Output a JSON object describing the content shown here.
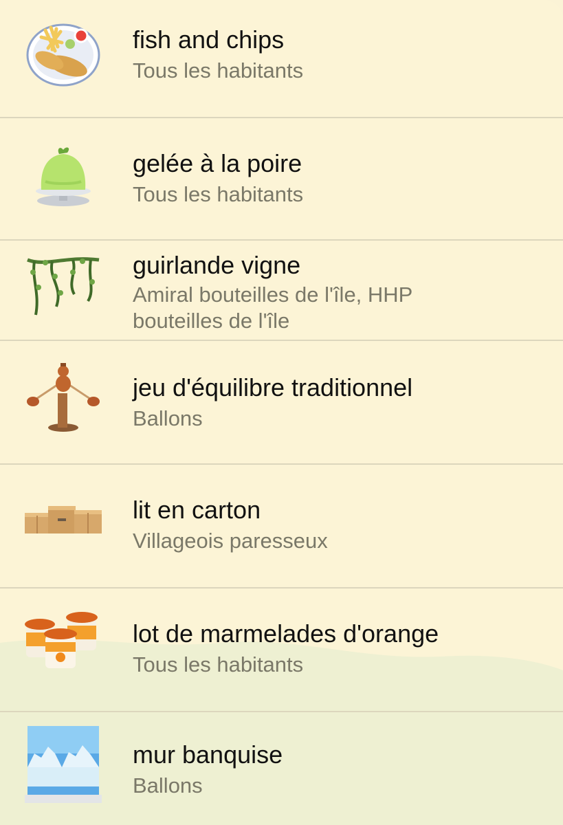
{
  "items": [
    {
      "title": "fish and chips",
      "subtitle": "Tous les habitants",
      "icon": "fish-and-chips-icon"
    },
    {
      "title": "gelée à la poire",
      "subtitle": "Tous les habitants",
      "icon": "pear-jelly-icon"
    },
    {
      "title": "guirlande vigne",
      "subtitle": "Amiral bouteilles de l'île, HHP bouteilles de l'île",
      "icon": "vine-garland-icon"
    },
    {
      "title": "jeu d'équilibre traditionnel",
      "subtitle": "Ballons",
      "icon": "balance-toy-icon"
    },
    {
      "title": "lit en carton",
      "subtitle": "Villageois paresseux",
      "icon": "cardboard-bed-icon"
    },
    {
      "title": "lot de marmelades d'orange",
      "subtitle": "Tous les habitants",
      "icon": "orange-marmalade-icon"
    },
    {
      "title": "mur banquise",
      "subtitle": "Ballons",
      "icon": "iceberg-wall-icon"
    }
  ],
  "colors": {
    "background": "#fcf4d6",
    "hill": "#ecefd0",
    "divider": "#dcd6bd",
    "title": "#111111",
    "subtitle": "#7a7868"
  }
}
